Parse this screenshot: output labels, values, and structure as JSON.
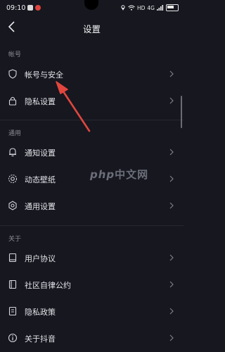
{
  "status_bar": {
    "time": "09:10",
    "network": "HD",
    "signal": "4G"
  },
  "header": {
    "title": "设置"
  },
  "sections": [
    {
      "title": "帐号",
      "items": [
        {
          "label": "帐号与安全",
          "icon": "shield-icon"
        },
        {
          "label": "隐私设置",
          "icon": "lock-icon"
        }
      ]
    },
    {
      "title": "通用",
      "items": [
        {
          "label": "通知设置",
          "icon": "bell-icon"
        },
        {
          "label": "动态壁纸",
          "icon": "wallpaper-icon"
        },
        {
          "label": "通用设置",
          "icon": "gear-icon"
        }
      ]
    },
    {
      "title": "关于",
      "items": [
        {
          "label": "用户协议",
          "icon": "document-icon"
        },
        {
          "label": "社区自律公约",
          "icon": "book-icon"
        },
        {
          "label": "隐私政策",
          "icon": "privacy-doc-icon"
        },
        {
          "label": "关于抖音",
          "icon": "info-icon"
        }
      ]
    }
  ],
  "watermark": {
    "text_en": "php",
    "text_cn": "中文网"
  },
  "colors": {
    "background": "#16171f",
    "arrow": "#e0463e",
    "text": "#e3e3e8",
    "section": "#8b8c94"
  }
}
